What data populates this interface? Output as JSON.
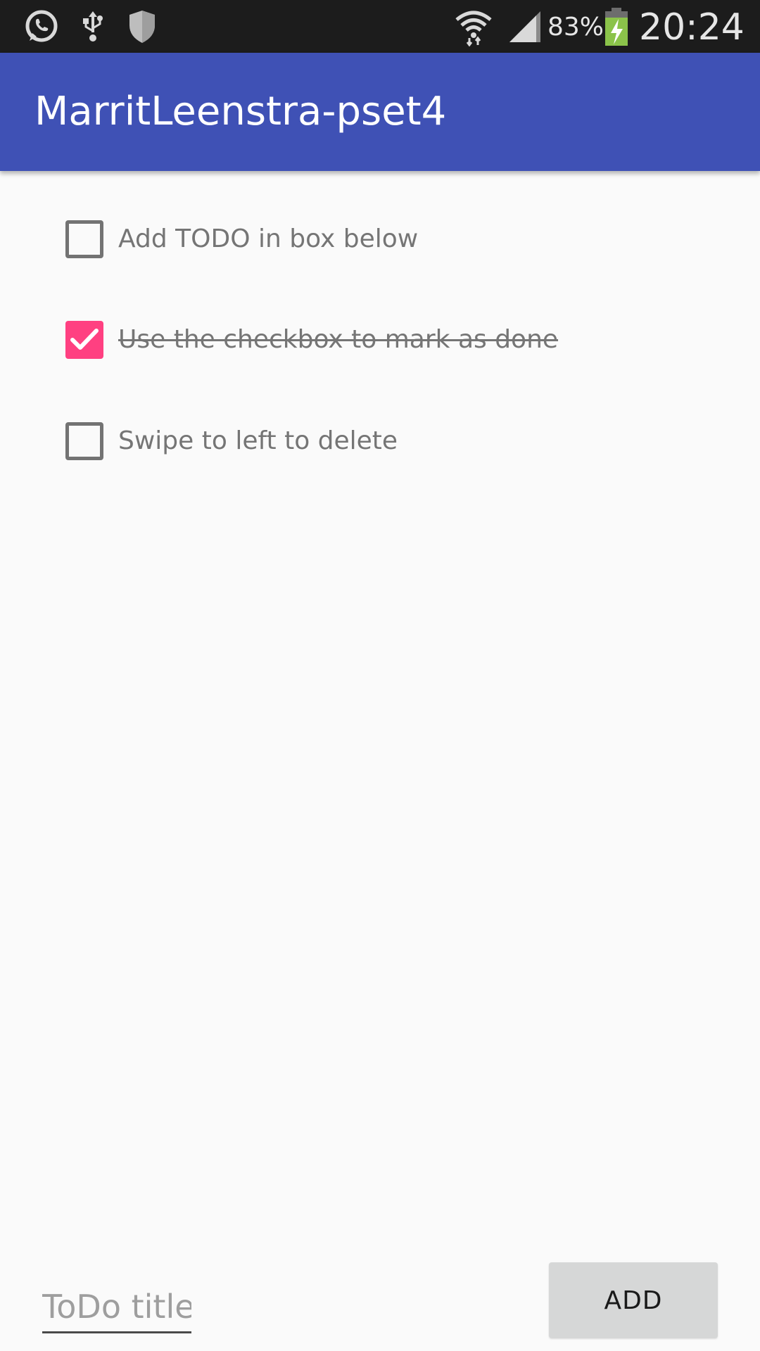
{
  "status_bar": {
    "icons_left": [
      "whatsapp-icon",
      "usb-icon",
      "shield-icon"
    ],
    "icons_right": [
      "wifi-icon",
      "signal-icon",
      "battery-charging-icon"
    ],
    "battery_percent": "83%",
    "time": "20:24"
  },
  "app_bar": {
    "title": "MarritLeenstra-pset4"
  },
  "todos": [
    {
      "text": "Add TODO in box below",
      "done": false
    },
    {
      "text": "Use the checkbox to mark as done",
      "done": true
    },
    {
      "text": "Swipe to left to delete",
      "done": false
    }
  ],
  "new_todo": {
    "placeholder": "ToDo title",
    "value": ""
  },
  "add_button": {
    "label": "ADD"
  },
  "colors": {
    "primary": "#3f51b5",
    "accent": "#ff4081",
    "status_bar": "#1c1c1c",
    "background": "#fafafa"
  }
}
